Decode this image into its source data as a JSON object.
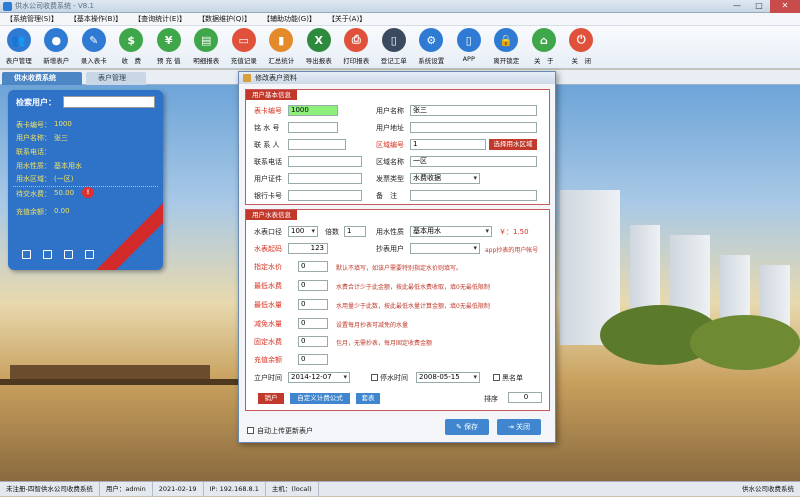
{
  "window": {
    "title": "供水公司收费系统 - V8.1",
    "min": "—",
    "max": "□",
    "close": "✕"
  },
  "menu": [
    "【系统管理(S)】",
    "【基本操作(B)】",
    "【查询统计(E)】",
    "【数据维护(Q)】",
    "【辅助功能(G)】",
    "【关于(A)】"
  ],
  "toolbar": [
    {
      "label": "表户管理",
      "icon": "users-icon",
      "glyph": "👥",
      "color": "#2f7bd4"
    },
    {
      "label": "新增表户",
      "icon": "user-add-icon",
      "glyph": "●",
      "color": "#2f7bd4"
    },
    {
      "label": "录入表卡",
      "icon": "edit-icon",
      "glyph": "✎",
      "color": "#2f7bd4"
    },
    {
      "label": "收　费",
      "icon": "dollar-icon",
      "glyph": "$",
      "color": "#3fa74a"
    },
    {
      "label": "预 充 值",
      "icon": "prepay-icon",
      "glyph": "¥",
      "color": "#3fa74a"
    },
    {
      "label": "明细报表",
      "icon": "report-icon",
      "glyph": "▤",
      "color": "#3fa74a"
    },
    {
      "label": "充值记录",
      "icon": "card-icon",
      "glyph": "▭",
      "color": "#e0513b"
    },
    {
      "label": "汇总统计",
      "icon": "bar-chart-icon",
      "glyph": "▮",
      "color": "#e58a2b"
    },
    {
      "label": "导出报表",
      "icon": "excel-icon",
      "glyph": "X",
      "color": "#2e8b3e"
    },
    {
      "label": "打印报表",
      "icon": "printer-icon",
      "glyph": "⎙",
      "color": "#e0513b"
    },
    {
      "label": "登记工单",
      "icon": "document-icon",
      "glyph": "▯",
      "color": "#3b4a5e"
    },
    {
      "label": "系统设置",
      "icon": "gear-icon",
      "glyph": "⚙",
      "color": "#2f7bd4"
    },
    {
      "label": "APP",
      "icon": "mobile-icon",
      "glyph": "▯",
      "color": "#2f7bd4"
    },
    {
      "label": "离开锁定",
      "icon": "lock-icon",
      "glyph": "🔒",
      "color": "#2f7bd4"
    },
    {
      "label": "关　于",
      "icon": "home-icon",
      "glyph": "⌂",
      "color": "#3fa74a"
    },
    {
      "label": "关　闭",
      "icon": "power-icon",
      "glyph": "⏻",
      "color": "#e0513b"
    }
  ],
  "tabs": {
    "main": "供水收费系统",
    "users": "表户管理"
  },
  "sidecard": {
    "search_label": "检索用户：",
    "rows": [
      {
        "k": "表卡编号：",
        "v": "1000"
      },
      {
        "k": "用户名称：",
        "v": "张三"
      },
      {
        "k": "联系电话：",
        "v": ""
      },
      {
        "k": "用水性质：",
        "v": "基本用水"
      },
      {
        "k": "用水区域：",
        "v": "(一区)"
      }
    ],
    "arrears_label": "待交水费：",
    "arrears_value": "50.00",
    "arrears_badge": "!",
    "balance_label": "充值余额：",
    "balance_value": "0.00"
  },
  "dialog": {
    "title": "修改表户资料",
    "basic": {
      "head": "用户基本信息",
      "card_no_label": "表卡编号",
      "card_no": "1000",
      "name_label": "用户名称",
      "name": "张三",
      "meter_no_label": "铭 水 号",
      "meter_no": "",
      "address_label": "用户地址",
      "address": "",
      "contact_label": "联 系 人",
      "contact": "",
      "area_code_label": "区域编号",
      "area_code": "1",
      "area_btn": "选择用水区域",
      "phone_label": "联系电话",
      "phone": "",
      "area_name_label": "区域名称",
      "area_name": "一区",
      "id_label": "用户证件",
      "id": "",
      "invoice_label": "发票类型",
      "invoice": "水费收据",
      "bank_label": "银行卡号",
      "bank": "",
      "remark_label": "备　注",
      "remark": ""
    },
    "water": {
      "head": "用户水表信息",
      "caliber_label": "水表口径",
      "caliber": "100",
      "multiple_label": "倍数",
      "multiple": "1",
      "nature_label": "用水性质",
      "nature": "基本用水",
      "price": "￥：1.50",
      "start_label": "水表起码",
      "start": "123",
      "reader_label": "抄表用户",
      "reader": "",
      "reader_hint": "app抄表的用户帐号",
      "fixed_price_label": "指定水价",
      "fixed_price": "0",
      "fixed_price_hint": "默认不填写，如该户需要特别指定水价则填写。",
      "min_fee_label": "最低水费",
      "min_fee": "0",
      "min_fee_hint": "水费合计少于此金额，按此最低水费收取，填0无最低限制",
      "min_vol_label": "最低水量",
      "min_vol": "0",
      "min_vol_hint": "水用量少于此数，按此最低水量计算金额，填0无最低限制",
      "reduce_label": "减免水量",
      "reduce": "0",
      "reduce_hint": "设置每月抄表可减免的水量",
      "fixed_fee_label": "固定水费",
      "fixed_fee": "0",
      "fixed_fee_hint": "包月，无需抄表，每月固定收费金额",
      "balance_label": "充值余额",
      "balance": "0",
      "open_date_label": "立户时间",
      "open_date": "2014-12-07",
      "stop_label": "停水时间",
      "stop_date": "2008-05-15",
      "blacklist_label": "黑名单",
      "btn_transfer": "销户",
      "btn_formula": "自定义计费公式",
      "btn_meter": "套表",
      "sort_label": "排序",
      "sort": "0"
    },
    "auto_update": "自动上传更新表户",
    "save": "保存",
    "close": "关闭"
  },
  "status": {
    "unregistered": "未注册-四智供水公司收费系统",
    "user": "用户：admin",
    "date": "2021-02-19",
    "ip": "IP: 192.168.8.1",
    "host": "主机：(local)",
    "brand": "供水公司收费系统"
  }
}
